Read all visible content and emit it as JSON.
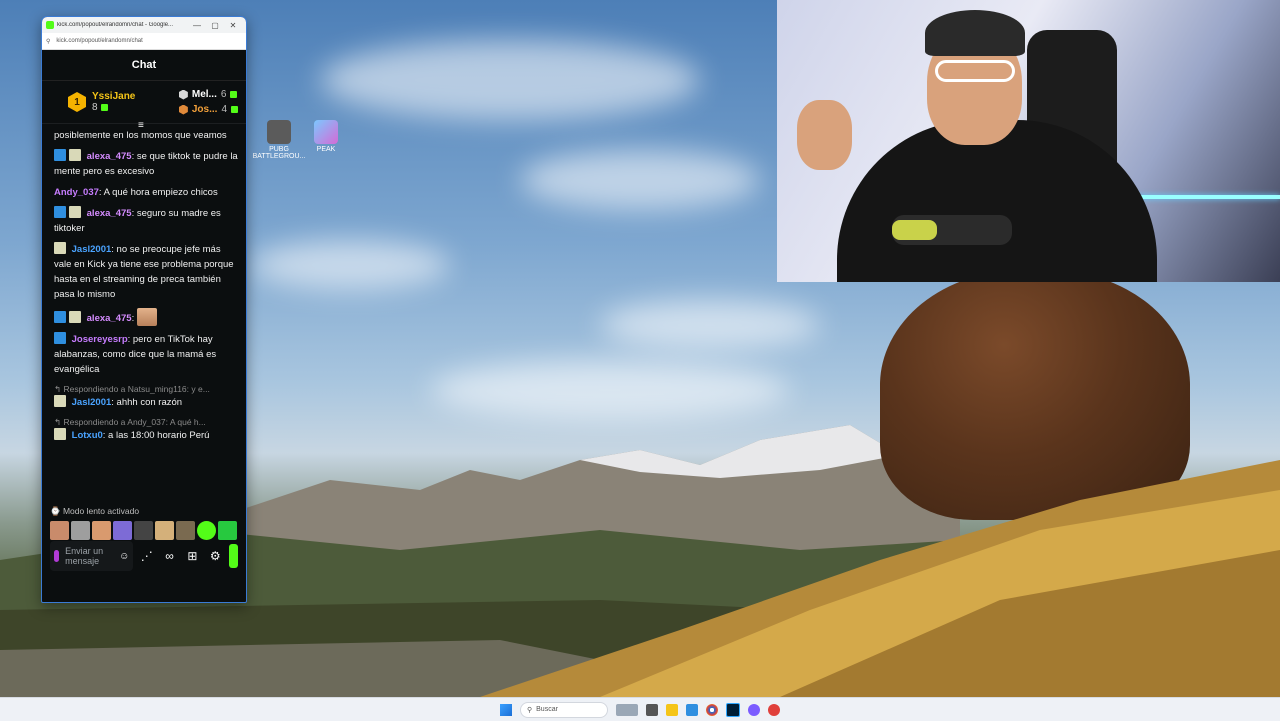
{
  "browser": {
    "title": "kick.com/popout/elrandomn/chat - Google...",
    "url": "kick.com/popout/elrandomn/chat",
    "minimize": "—",
    "maximize": "▢",
    "close": "✕"
  },
  "chat": {
    "header": "Chat",
    "leaderboard": {
      "first": {
        "rank": "1",
        "name": "YssiJane",
        "count": "8"
      },
      "second": {
        "name": "Mel...",
        "count": "6"
      },
      "third": {
        "name": "Jos...",
        "count": "4"
      }
    },
    "messages": [
      {
        "user": "",
        "text": "posiblemente en los momos que veamos",
        "user_color": "#ffffff"
      },
      {
        "user": "alexa_475",
        "text": ": se que tiktok te pudre la mente pero es excesivo",
        "user_color": "#d58cff"
      },
      {
        "user": "Andy_037",
        "text": ": A qué hora empiezo chicos",
        "user_color": "#c77dff"
      },
      {
        "user": "alexa_475",
        "text": ": seguro su madre es tiktoker",
        "user_color": "#d58cff"
      },
      {
        "user": "Jasl2001",
        "text": ": no se preocupe jefe más vale en Kick ya tiene ese problema porque hasta en el streaming de preca también pasa lo mismo",
        "user_color": "#4aa3ff"
      },
      {
        "user": "alexa_475",
        "text": ":",
        "user_color": "#d58cff"
      },
      {
        "user": "Josereyesrp",
        "text": ": pero en TikTok hay alabanzas, como dice que la mamá es evangélica",
        "user_color": "#c77dff"
      }
    ],
    "reply1": {
      "hint": "Respondiendo a Natsu_ming116: y e...",
      "user": "Jasl2001",
      "text": ": ahhh con razón"
    },
    "reply2": {
      "hint": "Respondiendo a Andy_037: A qué h...",
      "user": "Lotxu0",
      "text": ": a las 18:00 horario Perú"
    },
    "slow_mode": "Modo lento activado",
    "input_placeholder": "Enviar un mensaje",
    "emote_colors": [
      "#c98b6b",
      "#9e9e9e",
      "#d99a6e",
      "#7d6bd6",
      "#444444",
      "#d4b07a",
      "#7a6a50",
      "#53fc18",
      "#27c93f"
    ]
  },
  "desktop_icons": [
    {
      "label": "PUBG BATTLEGROU...",
      "icon": "pubg-icon"
    },
    {
      "label": "PEAK",
      "icon": "peak-icon"
    }
  ],
  "taskbar": {
    "search_placeholder": "Buscar",
    "apps": [
      "#9aa7b6",
      "#555555",
      "#f5c518",
      "#2f8fe0",
      "#1b6fd6",
      "#31a8ff",
      "#7b5cff",
      "#e0403b"
    ]
  },
  "colors": {
    "kick_green": "#53fc18",
    "window_border": "#3a7bd5"
  }
}
